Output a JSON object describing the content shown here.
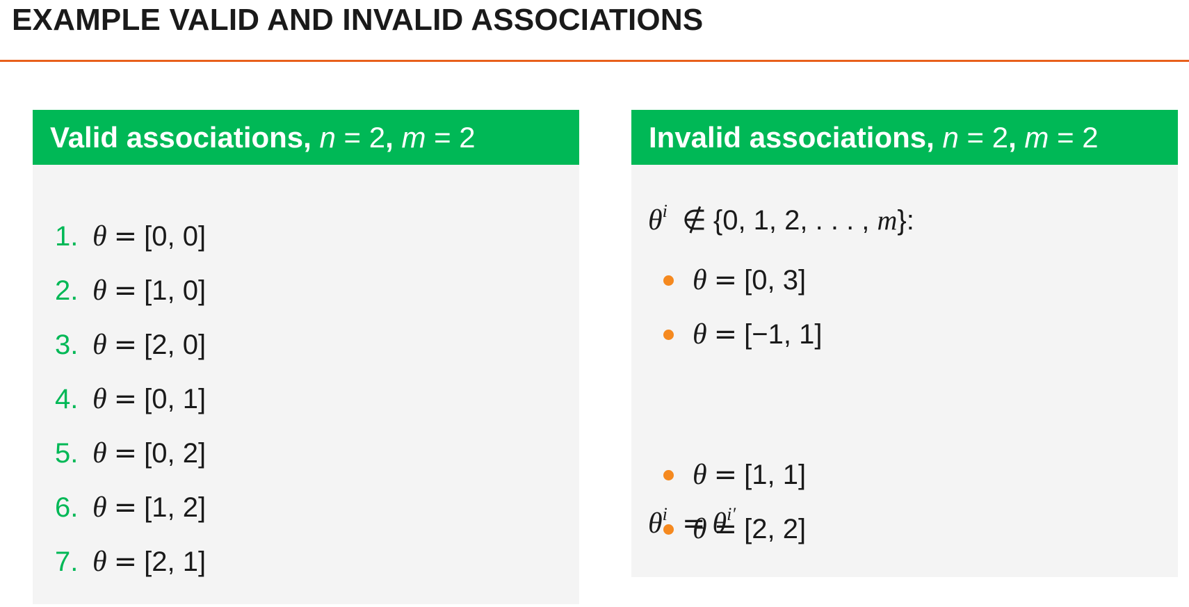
{
  "slide": {
    "title": "EXAMPLE VALID AND INVALID ASSOCIATIONS"
  },
  "valid_block": {
    "header_label": "Valid associations, ",
    "header_n": "n",
    "header_n_value": "= 2",
    "header_sep": ", ",
    "header_m": "m",
    "header_m_value": "= 2",
    "items": [
      {
        "number": "1.",
        "vector": "[0,  0]"
      },
      {
        "number": "2.",
        "vector": "[1,  0]"
      },
      {
        "number": "3.",
        "vector": "[2,  0]"
      },
      {
        "number": "4.",
        "vector": "[0,  1]"
      },
      {
        "number": "5.",
        "vector": "[0,  2]"
      },
      {
        "number": "6.",
        "vector": "[1,  2]"
      },
      {
        "number": "7.",
        "vector": "[2,  1]"
      }
    ]
  },
  "invalid_block": {
    "header_label": "Invalid associations, ",
    "header_n": "n",
    "header_n_value": "= 2",
    "header_sep": ", ",
    "header_m": "m",
    "header_m_value": "= 2",
    "rule_1": {
      "symbol": "θ",
      "superscript": "i",
      "relation": "∉",
      "set_open": "{0, 1, 2, . . . , ",
      "set_var": "m",
      "set_close": "}:"
    },
    "rule_1_items": [
      {
        "vector": "[0,  3]"
      },
      {
        "vector": "[−1,  1]"
      }
    ],
    "rule_2": {
      "symbol": "θ",
      "superscript": "i",
      "relation": "=",
      "rhs_symbol": "θ",
      "rhs_superscript": "i′"
    },
    "rule_2_items": [
      {
        "vector": "[1,  1]"
      },
      {
        "vector": "[2,  2]"
      }
    ]
  },
  "math": {
    "theta": "θ",
    "equals": "="
  },
  "colors": {
    "header_green": "#00b856",
    "title_rule_orange": "#e8601c",
    "bullet_orange": "#f5891f",
    "block_background": "#f4f4f4"
  }
}
